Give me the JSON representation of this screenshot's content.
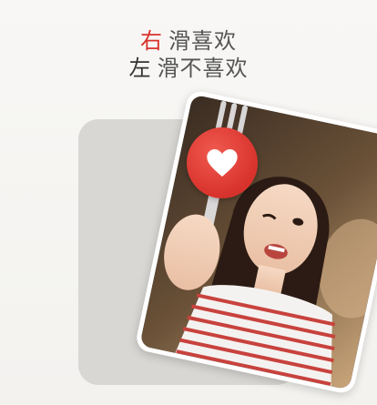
{
  "instructions": {
    "right_direction": "右",
    "right_action": "滑喜欢",
    "left_direction": "左",
    "left_action": "滑不喜欢"
  },
  "icons": {
    "like": "heart-icon"
  },
  "colors": {
    "accent": "#d8322c",
    "card_back": "#d8d7d4"
  }
}
